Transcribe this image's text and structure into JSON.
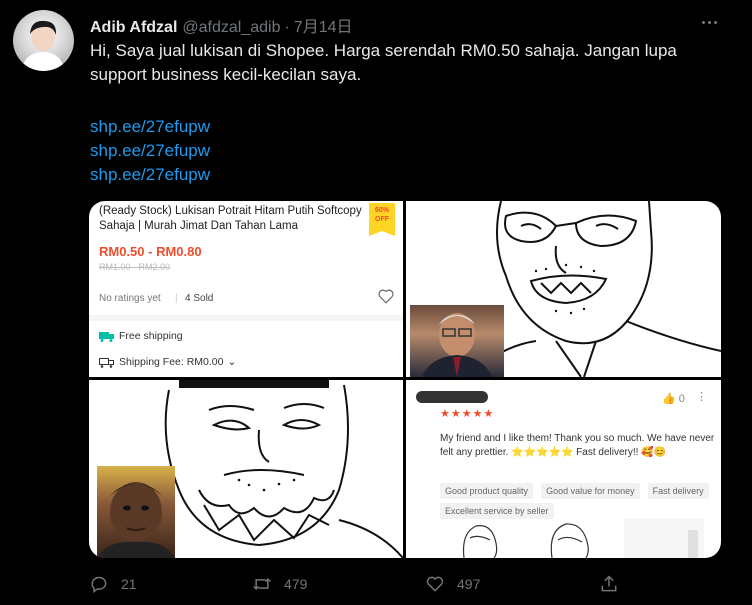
{
  "author": {
    "name": "Adib Afdzal",
    "handle": "@afdzal_adib",
    "separator": "·",
    "date": "7月14日"
  },
  "tweet": {
    "text": "Hi, Saya jual lukisan di Shopee. Harga serendah RM0.50 sahaja. Jangan lupa support business kecil-kecilan saya.",
    "links": [
      "shp.ee/27efupw",
      "shp.ee/27efupw",
      "shp.ee/27efupw"
    ]
  },
  "product": {
    "title": "(Ready Stock) Lukisan Potrait Hitam Putih Softcopy Sahaja | Murah Jimat Dan Tahan Lama",
    "badge_pct": "60%",
    "badge_off": "OFF",
    "price": "RM0.50 - RM0.80",
    "old_price": "RM1.00 - RM2.00",
    "rating": "No ratings yet",
    "sold": "4 Sold",
    "free_shipping": "Free shipping",
    "shipping_fee": "Shipping Fee: RM0.00"
  },
  "review": {
    "stars": "★★★★★",
    "likes": "0",
    "text": "My friend and I like them! Thank you so much. We have never felt any prettier. ⭐⭐⭐⭐⭐ Fast delivery!! 🥰😊",
    "tags": [
      "Good product quality",
      "Good value for money",
      "Fast delivery",
      "Excellent service by seller"
    ]
  },
  "actions": {
    "replies": "21",
    "retweets": "479",
    "likes": "497"
  },
  "colors": {
    "link": "#1d9bf0",
    "muted": "#71767b",
    "shopee": "#ee4d2d"
  },
  "icons": [
    "more-icon",
    "reply-icon",
    "retweet-icon",
    "like-icon",
    "share-icon",
    "heart-outline-icon",
    "truck-icon",
    "thumb-up-icon"
  ]
}
